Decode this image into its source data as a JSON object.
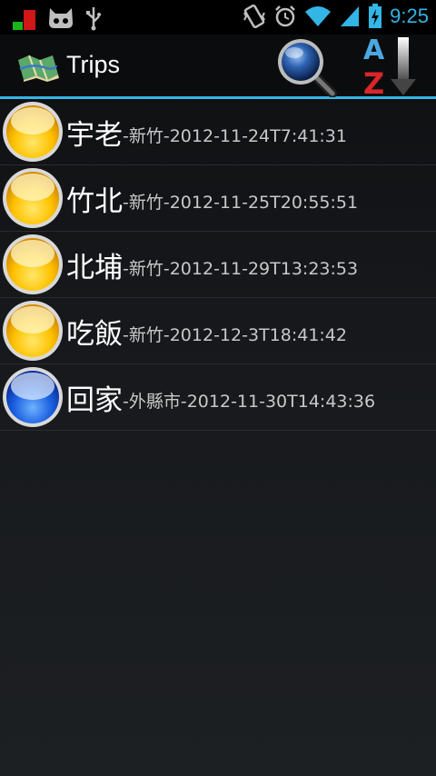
{
  "status_bar": {
    "time": "9:25",
    "icons": [
      "notification-red-green-icon",
      "cyanogen-mod-icon",
      "usb-icon",
      "vibrate-icon",
      "alarm-icon",
      "wifi-icon",
      "signal-icon",
      "battery-charging-icon"
    ]
  },
  "action_bar": {
    "title": "Trips",
    "app_icon": "map-icon",
    "actions": [
      "search-icon",
      "sort-az-icon"
    ],
    "accent_color": "#33b5e5"
  },
  "trips": [
    {
      "name": "宇老",
      "detail": "-新竹-2012-11-24T7:41:31",
      "color": "yellow"
    },
    {
      "name": "竹北",
      "detail": "-新竹-2012-11-25T20:55:51",
      "color": "yellow"
    },
    {
      "name": "北埔",
      "detail": "-新竹-2012-11-29T13:23:53",
      "color": "yellow"
    },
    {
      "name": "吃飯",
      "detail": "-新竹-2012-12-3T18:41:42",
      "color": "yellow"
    },
    {
      "name": "回家",
      "detail": "-外縣市-2012-11-30T14:43:36",
      "color": "blue"
    }
  ]
}
